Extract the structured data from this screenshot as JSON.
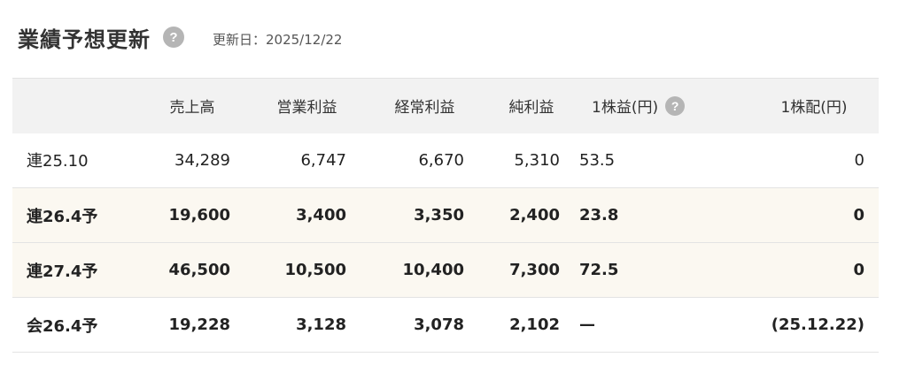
{
  "header": {
    "title": "業績予想更新",
    "help_glyph": "?",
    "updated_label": "更新日：2025/12/22"
  },
  "table": {
    "headers": {
      "label": "",
      "sales": "売上高",
      "operating": "営業利益",
      "ordinary": "経常利益",
      "net": "純利益",
      "eps": "1株益(円)",
      "dividend": "1株配(円)"
    },
    "rows": [
      {
        "label": "連25.10",
        "sales": "34,289",
        "operating": "6,747",
        "ordinary": "6,670",
        "net": "5,310",
        "eps": "53.5",
        "dividend": "0"
      },
      {
        "label": "連26.4予",
        "sales": "19,600",
        "operating": "3,400",
        "ordinary": "3,350",
        "net": "2,400",
        "eps": "23.8",
        "dividend": "0"
      },
      {
        "label": "連27.4予",
        "sales": "46,500",
        "operating": "10,500",
        "ordinary": "10,400",
        "net": "7,300",
        "eps": "72.5",
        "dividend": "0"
      },
      {
        "label": "会26.4予",
        "sales": "19,228",
        "operating": "3,128",
        "ordinary": "3,078",
        "net": "2,102",
        "eps": "—",
        "dividend": "(25.12.22)"
      }
    ]
  },
  "colors": {
    "header_bg": "#f2f2f2",
    "highlight_row_bg": "#fbf8f1",
    "help_icon_bg": "#b5b5b5",
    "border": "#e3e3e3"
  },
  "icons": {
    "help": "question-circle-icon"
  }
}
